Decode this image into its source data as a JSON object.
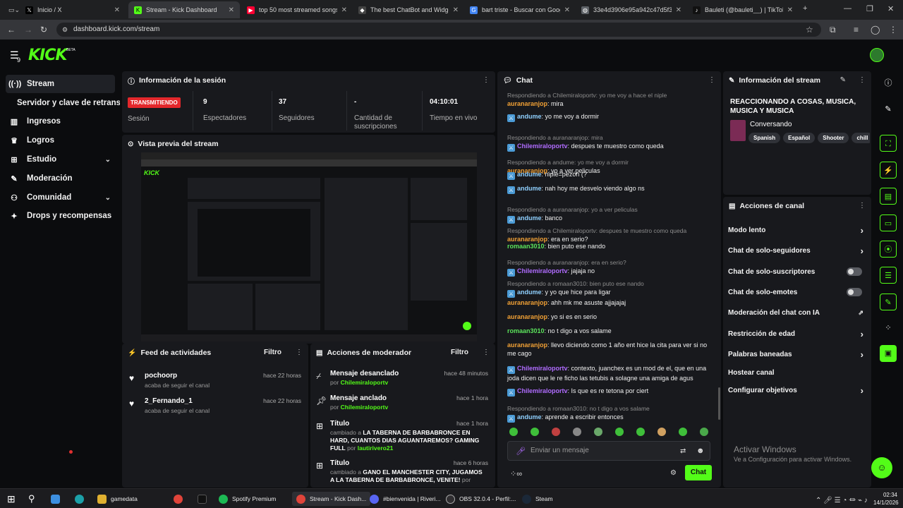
{
  "browser": {
    "tabs": [
      {
        "label": "Inicio / X",
        "icon": "x-icon",
        "color": "#000000"
      },
      {
        "label": "Stream - Kick Dashboard",
        "icon": "kick-icon",
        "color": "#53fc18"
      },
      {
        "label": "top 50 most streamed songs fr",
        "icon": "youtube-icon",
        "color": "#ff0033"
      },
      {
        "label": "The best ChatBot and Widgets",
        "icon": "chatbot-icon",
        "color": "#ffffff"
      },
      {
        "label": "bart triste - Buscar con Google",
        "icon": "google-icon",
        "color": "#4285f4"
      },
      {
        "label": "33e4d3906e95a942c47d5f3672",
        "icon": "globe-icon",
        "color": "#9aa0a6"
      },
      {
        "label": "Bauleti (@bauleti__) | TikTok",
        "icon": "tiktok-icon",
        "color": "#000000"
      }
    ],
    "url": "dashboard.kick.com/stream"
  },
  "brand": {
    "logo": "KICK",
    "beta": "BETA",
    "accent": "#53fc18"
  },
  "sidebar": {
    "items": [
      {
        "label": "Stream",
        "icon": "broadcast-icon",
        "active": true
      },
      {
        "label": "Servidor y clave de retransmisión",
        "icon": ""
      },
      {
        "label": "Ingresos",
        "icon": "chart-icon"
      },
      {
        "label": "Logros",
        "icon": "trophy-icon"
      },
      {
        "label": "Estudio",
        "icon": "studio-icon"
      },
      {
        "label": "Moderación",
        "icon": "wrench-icon"
      },
      {
        "label": "Comunidad",
        "icon": "people-icon"
      },
      {
        "label": "Drops y recompensas",
        "icon": "gift-icon"
      }
    ]
  },
  "session": {
    "title": "Información de la sesión",
    "live_badge": "TRANSMITIENDO",
    "live_label": "Sesión",
    "stats": [
      {
        "value": "9",
        "label": "Espectadores"
      },
      {
        "value": "37",
        "label": "Seguidores"
      },
      {
        "value": "-",
        "label": "Cantidad de suscripciones"
      },
      {
        "value": "04:10:01",
        "label": "Tiempo en vivo"
      }
    ]
  },
  "preview": {
    "title": "Vista previa del stream"
  },
  "feed": {
    "title": "Feed de actividades",
    "filter": "Filtro",
    "items": [
      {
        "name": "pochoorp",
        "action": "acaba de seguir el canal",
        "time": "hace 22 horas"
      },
      {
        "name": "2_Fernando_1",
        "action": "acaba de seguir el canal",
        "time": "hace 22 horas"
      }
    ]
  },
  "modactions": {
    "title": "Acciones de moderador",
    "filter": "Filtro",
    "items": [
      {
        "title": "Mensaje desanclado",
        "by": "por",
        "user": "Chilemiraloportv",
        "time": "hace 48 minutos"
      },
      {
        "title": "Mensaje anclado",
        "by": "por",
        "user": "Chilemiraloportv",
        "time": "hace 1 hora"
      },
      {
        "title": "Título",
        "changed": "cambiado a",
        "value": "LA TABERNA DE BARBABRONCE EN HARD, CUANTOS DIAS AGUANTAREMOS? GAMING FULL",
        "by": "por",
        "user": "lautirivero21",
        "time": "hace 1 hora"
      },
      {
        "title": "Título",
        "changed": "cambiado a",
        "value": "GANO EL MANCHESTER CITY, JUGAMOS A LA TABERNA DE BARBABRONCE, VENITE!",
        "by": "por",
        "time": "hace 6 horas"
      }
    ]
  },
  "chat": {
    "title": "Chat",
    "messages": [
      {
        "reply": "Respondiendo a Chilemiraloportv: yo me voy a hace el niple",
        "user": "auranaranjop",
        "ucolor": "or",
        "text": "mira"
      },
      {
        "reply": "",
        "user": "andume",
        "ucolor": "bl",
        "text": "yo me voy a dormir"
      },
      {
        "reply": "Respondiendo a auranaranjop: mira",
        "user": "Chilemiraloportv",
        "ucolor": "pu",
        "text": "despues te muestro como queda"
      },
      {
        "reply": "Respondiendo a andume: yo me voy a dormir",
        "user": "auranaranjop",
        "ucolor": "or",
        "text": "yo a ver peliculas"
      },
      {
        "reply": "",
        "user": "andume",
        "ucolor": "bl",
        "text": "niple=pezón (?"
      },
      {
        "reply": "",
        "user": "andume",
        "ucolor": "bl",
        "text": "nah hoy me desvelo viendo algo ns"
      },
      {
        "reply": "Respondiendo a auranaranjop: yo a ver peliculas",
        "user": "andume",
        "ucolor": "bl",
        "text": "banco"
      },
      {
        "reply": "Respondiendo a Chilemiraloportv: despues te muestro como queda",
        "user": "auranaranjop",
        "ucolor": "or",
        "text": "era en serio?"
      },
      {
        "reply": "",
        "user": "romaan3010",
        "ucolor": "gr",
        "text": "bien puto ese nando"
      },
      {
        "reply": "Respondiendo a auranaranjop: era en serio?",
        "user": "Chilemiraloportv",
        "ucolor": "pu",
        "text": "jajaja no"
      },
      {
        "reply": "Respondiendo a romaan3010: bien puto ese nando",
        "user": "andume",
        "ucolor": "bl",
        "text": "y yo que hice para ligar"
      },
      {
        "reply": "",
        "user": "auranaranjop",
        "ucolor": "or",
        "text": "ahh mk me asuste ajjajajaj"
      },
      {
        "reply": "",
        "user": "auranaranjop",
        "ucolor": "or",
        "text": "yo si es en serio"
      },
      {
        "reply": "",
        "user": "romaan3010",
        "ucolor": "gr",
        "text": "no t digo a vos salame"
      },
      {
        "reply": "",
        "user": "auranaranjop",
        "ucolor": "or",
        "text": "llevo diciendo como 1 año ent hice la cita para ver si no me cago"
      },
      {
        "reply": "",
        "user": "Chilemiraloportv",
        "ucolor": "pu",
        "text": "contexto, juanchex es un mod de el, que en una joda dicen que le re ficho las tetubis a solagne una amiga de agus"
      },
      {
        "reply": "",
        "user": "Chilemiraloportv",
        "ucolor": "pu",
        "text": "Is que es re tetona por ciert"
      },
      {
        "reply": "Respondiendo a romaan3010: no t digo a vos salame",
        "user": "andume",
        "ucolor": "bl",
        "text": "aprende a escribir entonces"
      }
    ],
    "input_placeholder": "Enviar un mensaje",
    "send_label": "Chat"
  },
  "streaminfo": {
    "title": "Información del stream",
    "stream_title": "REACCIONANDO A COSAS, MUSICA, MUSICA Y MUSICA",
    "category": "Conversando",
    "tags": [
      "Spanish",
      "Español",
      "Shooter",
      "chill"
    ]
  },
  "channel_actions": {
    "title": "Acciones de canal",
    "items": [
      {
        "label": "Modo lento",
        "control": "arrow"
      },
      {
        "label": "Chat de solo-seguidores",
        "control": "arrow"
      },
      {
        "label": "Chat de solo-suscriptores",
        "control": "toggle"
      },
      {
        "label": "Chat de solo-emotes",
        "control": "toggle"
      },
      {
        "label": "Moderación del chat con IA",
        "control": "external"
      },
      {
        "label": "Restricción de edad",
        "control": "arrow"
      },
      {
        "label": "Palabras baneadas",
        "control": "arrow"
      },
      {
        "label": "Hostear canal",
        "control": "none"
      },
      {
        "label": "Configurar objetivos",
        "control": "arrow"
      }
    ]
  },
  "windows_notice": {
    "title": "Activar Windows",
    "subtitle": "Ve a Configuración para activar Windows."
  },
  "taskbar": {
    "items": [
      "gamedata",
      "Spotify Premium",
      "Stream - Kick Dash...",
      "#bienvenida | Riveri...",
      "OBS 32.0.4 - Perfil:...",
      "Steam"
    ],
    "time": "02:34",
    "date": "14/1/2026"
  }
}
